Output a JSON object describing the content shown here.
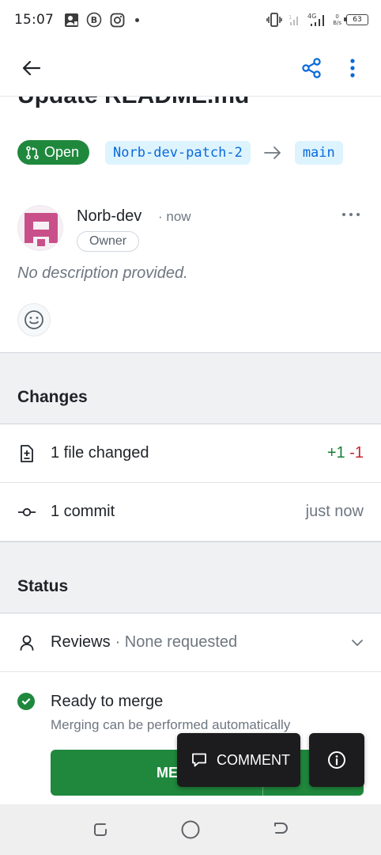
{
  "status_bar": {
    "time": "15:07",
    "network": "4G",
    "net_speed_value": "0",
    "net_speed_unit": "B/s",
    "battery": "63"
  },
  "app_bar": {
    "back_icon": "arrow-left-icon",
    "share_icon": "share-icon",
    "more_icon": "kebab-menu-icon"
  },
  "pr": {
    "title": "Update README.md",
    "state": "Open",
    "head_branch": "Norb-dev-patch-2",
    "base_branch": "main"
  },
  "author": {
    "name": "Norb-dev",
    "time": "· now",
    "role": "Owner",
    "description": "No description provided."
  },
  "changes": {
    "heading": "Changes",
    "files_label": "1 file changed",
    "additions": "+1",
    "deletions": "-1",
    "commits_label": "1 commit",
    "commits_time": "just now"
  },
  "status": {
    "heading": "Status",
    "reviews_label": "Reviews",
    "reviews_value": "· None requested",
    "merge_title": "Ready to merge",
    "merge_subtitle": "Merging can be performed automatically",
    "merge_button": "ME"
  },
  "fab": {
    "comment_label": "COMMENT"
  },
  "colors": {
    "success": "#1f883d",
    "link": "#0969da",
    "danger": "#cf222e",
    "fab_bg": "#1c1c1e"
  }
}
